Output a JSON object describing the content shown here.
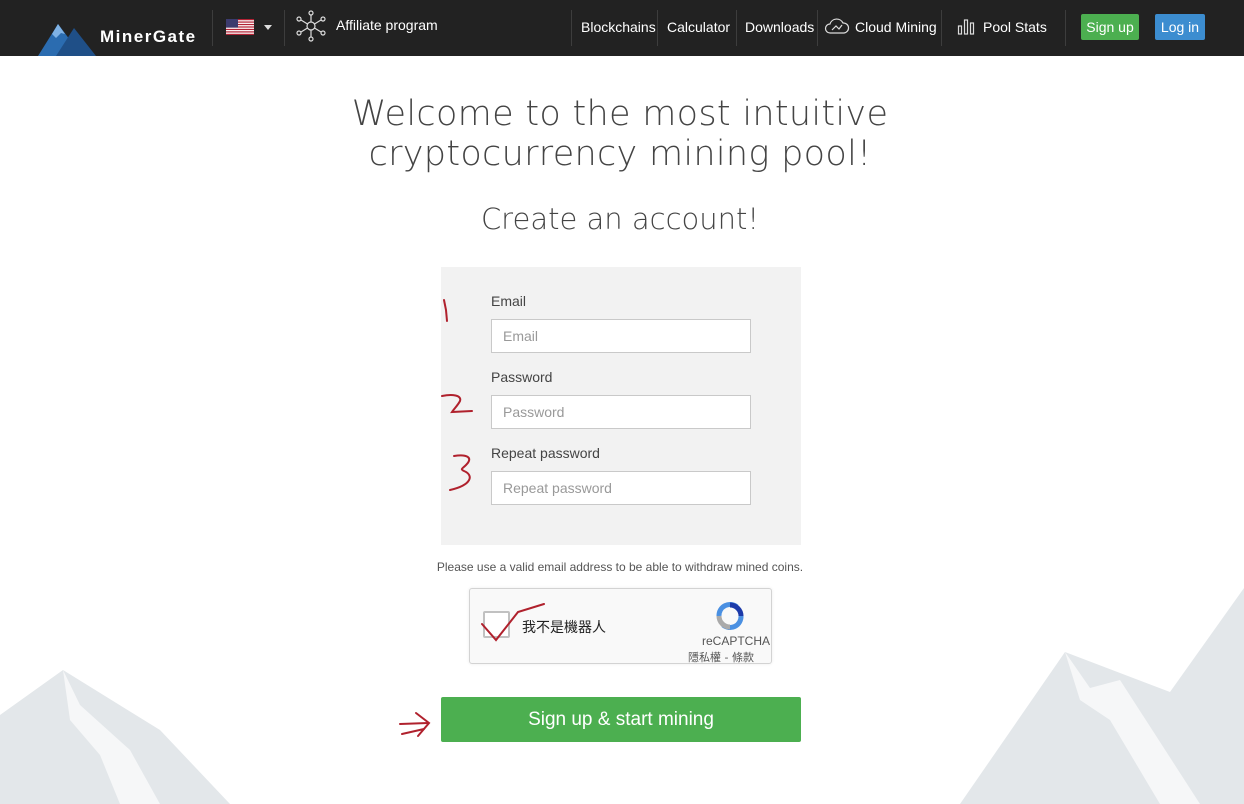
{
  "brand": {
    "name": "MinerGate",
    "accent": "#4caf50",
    "link_blue": "#3c8dd0"
  },
  "header": {
    "language_icon": "us-flag-icon",
    "affiliate": {
      "icon": "network-nodes-icon",
      "label": "Affiliate program"
    },
    "nav": [
      {
        "label": "Blockchains"
      },
      {
        "label": "Calculator"
      },
      {
        "label": "Downloads"
      },
      {
        "label": "Cloud Mining",
        "icon": "cloud-mining-icon"
      },
      {
        "label": "Pool Stats",
        "icon": "bar-chart-icon"
      }
    ],
    "signup_label": "Sign up",
    "login_label": "Log in"
  },
  "hero": {
    "title": "Welcome to the most intuitive cryptocurrency mining pool!",
    "subtitle": "Create an account!"
  },
  "form": {
    "email": {
      "label": "Email",
      "placeholder": "Email",
      "value": ""
    },
    "password": {
      "label": "Password",
      "placeholder": "Password",
      "value": ""
    },
    "repeat_password": {
      "label": "Repeat password",
      "placeholder": "Repeat password",
      "value": ""
    },
    "note": "Please use a valid email address to be able to withdraw mined coins.",
    "submit_label": "Sign up & start mining"
  },
  "recaptcha": {
    "checkbox_label": "我不是機器人",
    "brand": "reCAPTCHA",
    "privacy": "隱私權",
    "separator": " - ",
    "terms": "條款"
  },
  "annotations": [
    "1",
    "2",
    "3",
    "checkmark",
    "arrow"
  ]
}
